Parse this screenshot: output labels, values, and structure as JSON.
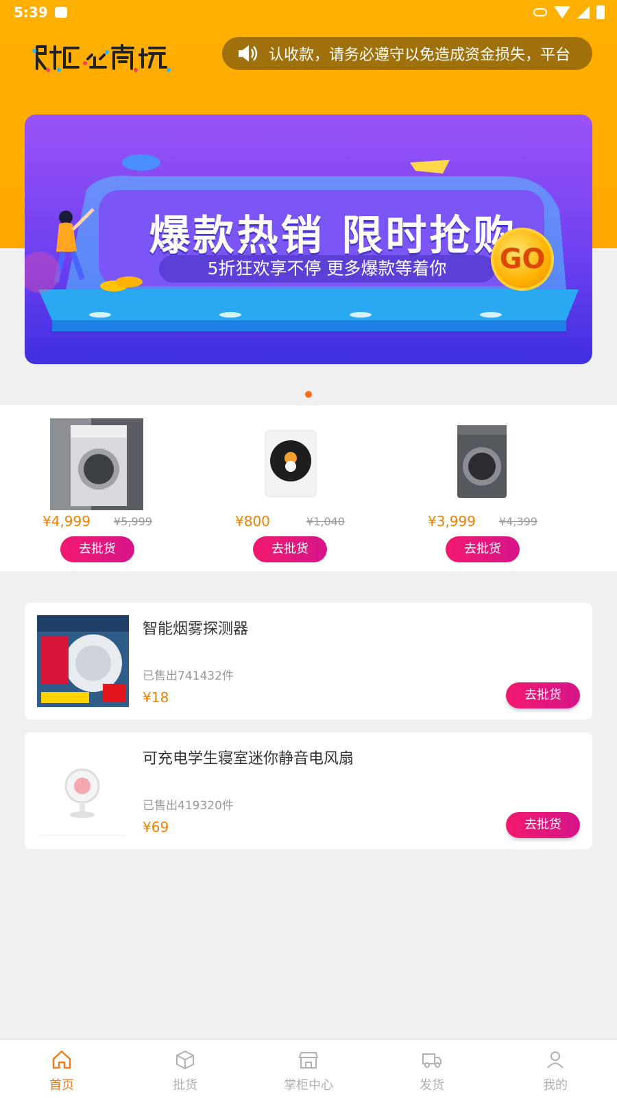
{
  "status_bar": {
    "time": "5:39"
  },
  "header": {
    "logo_text": "限淘商城",
    "notice": "认收款，请务必遵守以免造成资金损失，平台"
  },
  "banner": {
    "title": "爆款热销 限时抢购",
    "subtitle": "5折狂欢享不停 更多爆款等着你",
    "badge": "GO"
  },
  "hot_products": [
    {
      "price": "¥4,999",
      "old_price": "¥5,999",
      "button": "去批货",
      "image": "front-load-washing-machine"
    },
    {
      "price": "¥800",
      "old_price": "¥1,040",
      "button": "去批货",
      "image": "mini-washing-machine"
    },
    {
      "price": "¥3,999",
      "old_price": "¥4,399",
      "button": "去批货",
      "image": "dark-washing-machine"
    }
  ],
  "products": [
    {
      "title": "智能烟雾探测器",
      "sold": "已售出741432件",
      "price": "¥18",
      "button": "去批货",
      "image": "smoke-detector"
    },
    {
      "title": "可充电学生寝室迷你静音电风扇",
      "sold": "已售出419320件",
      "price": "¥69",
      "button": "去批货",
      "image": "mini-fan"
    }
  ],
  "nav": [
    {
      "label": "首页",
      "icon": "home-icon",
      "active": true
    },
    {
      "label": "批货",
      "icon": "box-icon",
      "active": false
    },
    {
      "label": "掌柜中心",
      "icon": "store-icon",
      "active": false
    },
    {
      "label": "发货",
      "icon": "truck-icon",
      "active": false
    },
    {
      "label": "我的",
      "icon": "user-icon",
      "active": false
    }
  ],
  "colors": {
    "header": "#ffa900",
    "price": "#f08000",
    "button": "#f2196e",
    "nav_active": "#f47c1a"
  }
}
